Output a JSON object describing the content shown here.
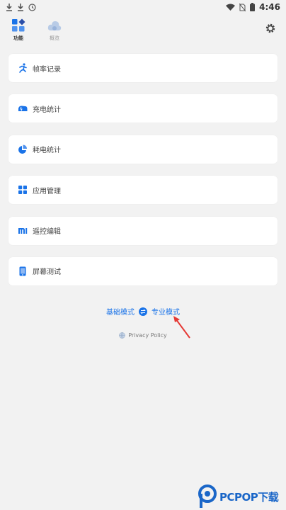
{
  "status_bar": {
    "time": "4:46"
  },
  "nav": {
    "tabs": [
      {
        "label": "功能",
        "active": true,
        "icon": "grid-diamond-icon"
      },
      {
        "label": "概览",
        "active": false,
        "icon": "cloud-icon"
      }
    ],
    "settings_icon": "gear-icon"
  },
  "menu": {
    "items": [
      {
        "label": "帧率记录",
        "icon": "running-man-icon",
        "color": "#1a73e8"
      },
      {
        "label": "充电统计",
        "icon": "charging-car-icon",
        "color": "#1a73e8"
      },
      {
        "label": "耗电统计",
        "icon": "pie-chart-icon",
        "color": "#1a73e8"
      },
      {
        "label": "应用管理",
        "icon": "app-grid-icon",
        "color": "#1a73e8"
      },
      {
        "label": "遥控编辑",
        "icon": "mi-logo-icon",
        "color": "#1a73e8"
      },
      {
        "label": "屏幕测试",
        "icon": "phone-screen-icon",
        "color": "#1a73e8"
      }
    ]
  },
  "mode_switch": {
    "basic": "基础模式",
    "pro": "专业模式",
    "icon": "swap-icon"
  },
  "privacy": {
    "label": "Privacy Policy",
    "icon": "globe-icon"
  },
  "watermark": {
    "text": "PCPOP下载"
  },
  "colors": {
    "accent": "#1a73e8",
    "background": "#f2f2f2",
    "arrow": "#e53935"
  }
}
